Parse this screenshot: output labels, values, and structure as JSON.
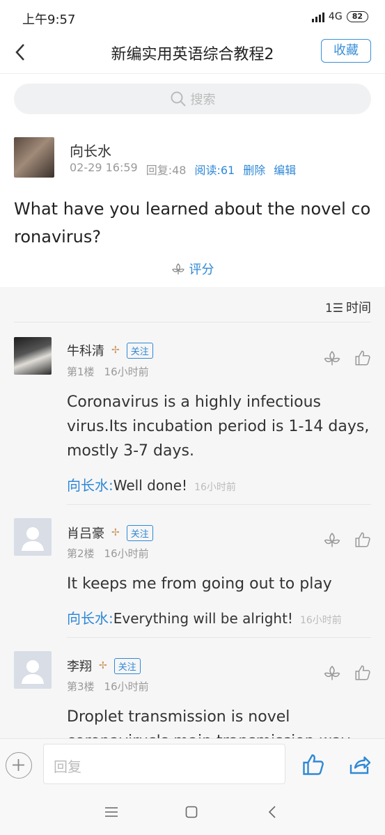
{
  "status": {
    "time": "上午9:57",
    "network": "4G",
    "battery": "82"
  },
  "header": {
    "title": "新编实用英语综合教程2",
    "fav_label": "收藏"
  },
  "search": {
    "placeholder": "搜索"
  },
  "post": {
    "author": "向长水",
    "date": "02-29 16:59",
    "replies": "回复:48",
    "reads": "阅读:61",
    "delete_label": "删除",
    "edit_label": "编辑",
    "body": "What have you learned about the novel coronavirus?",
    "rate_label": "评分"
  },
  "sort": {
    "label": "时间"
  },
  "comments": [
    {
      "name": "牛科清",
      "follow": "关注",
      "floor": "第1楼",
      "time": "16小时前",
      "text": "Coronavirus is a highly infectious virus.Its incubation period is 1-14 days, mostly 3-7 days.",
      "reply_name": "向长水:",
      "reply_text": "Well done!",
      "reply_time": "16小时前"
    },
    {
      "name": "肖吕豪",
      "follow": "关注",
      "floor": "第2楼",
      "time": "16小时前",
      "text": "It keeps me from going out to play",
      "reply_name": "向长水:",
      "reply_text": "Everything will be alright!",
      "reply_time": "16小时前"
    },
    {
      "name": "李翔",
      "follow": "关注",
      "floor": "第3楼",
      "time": "16小时前",
      "text": "Droplet transmission is novel coronavirus's main transmission way"
    }
  ],
  "bottom": {
    "reply_placeholder": "回复"
  },
  "colors": {
    "accent": "#2f88d6",
    "background": "#ffffff",
    "comment_bg": "#f6f6f6"
  }
}
